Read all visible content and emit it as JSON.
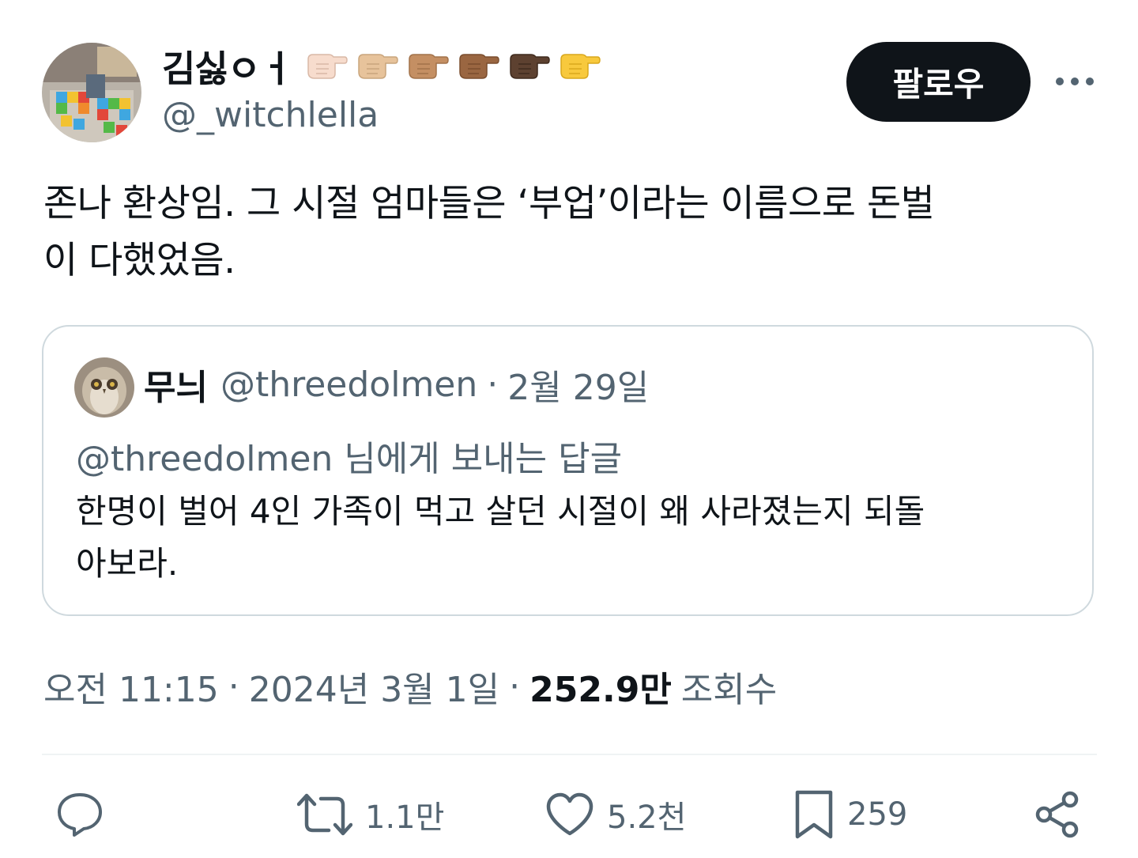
{
  "author": {
    "display_name": "김싫ㅇㅓ",
    "handle": "@_witchlella",
    "emoji": [
      {
        "name": "hand-pointing-right-light-icon",
        "color": "#f7dccd"
      },
      {
        "name": "hand-pointing-right-medium-light-icon",
        "color": "#e7c39b"
      },
      {
        "name": "hand-pointing-right-medium-icon",
        "color": "#c48f63"
      },
      {
        "name": "hand-pointing-right-medium-dark-icon",
        "color": "#9a6641"
      },
      {
        "name": "hand-pointing-right-dark-icon",
        "color": "#5d4130"
      },
      {
        "name": "hand-pointing-right-yellow-icon",
        "color": "#f8c93d"
      }
    ]
  },
  "follow_label": "팔로우",
  "tweet_text": "존나 환상임. 그 시절 엄마들은 ‘부업’이라는 이름으로 돈벌\n이 다했었음.",
  "quote": {
    "name": "무늬",
    "handle": "@threedolmen",
    "separator": "·",
    "date": "2월 29일",
    "reply_to": "@threedolmen 님에게 보내는 답글",
    "text": "한명이 벌어 4인 가족이 먹고 살던 시절이 왜 사라졌는지 되돌\n아보라."
  },
  "meta": {
    "time": "오전 11:15",
    "separator": "·",
    "date": "2024년 3월 1일",
    "views_count": "252.9만",
    "views_label": "조회수"
  },
  "actions": {
    "reply": {
      "icon": "reply-icon",
      "count": ""
    },
    "retweet": {
      "icon": "retweet-icon",
      "count": "1.1만"
    },
    "like": {
      "icon": "heart-icon",
      "count": "5.2천"
    },
    "bookmark": {
      "icon": "bookmark-icon",
      "count": "259"
    },
    "share": {
      "icon": "share-icon",
      "count": ""
    }
  },
  "colors": {
    "text_primary": "#0f1419",
    "text_secondary": "#536471",
    "border": "#cfd9de",
    "button_bg": "#0f1419"
  }
}
